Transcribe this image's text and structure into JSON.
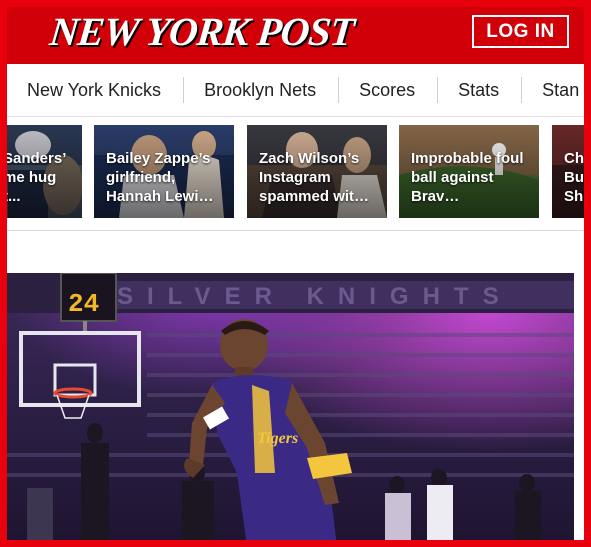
{
  "header": {
    "logo": "NEW YORK POST",
    "login_label": "LOG IN",
    "brand_color": "#d10008"
  },
  "nav": {
    "items": [
      {
        "label": "New York Knicks"
      },
      {
        "label": "Brooklyn Nets"
      },
      {
        "label": "Scores"
      },
      {
        "label": "Stats"
      },
      {
        "label": "Stan"
      }
    ]
  },
  "trending": {
    "cards": [
      {
        "text": "Sanders’ me hug t..."
      },
      {
        "text": "Bailey Zappe’s girlfriend, Hannah Lewi…"
      },
      {
        "text": "Zach Wilson’s Instagram spammed wit…"
      },
      {
        "text": "Improbable foul ball against Brav…"
      },
      {
        "text": "Ch Bu Sh"
      }
    ]
  },
  "hero": {
    "shot_clock": "24",
    "arena_banner": "SILVER KNIGHTS",
    "jersey_text": "Tigers"
  }
}
